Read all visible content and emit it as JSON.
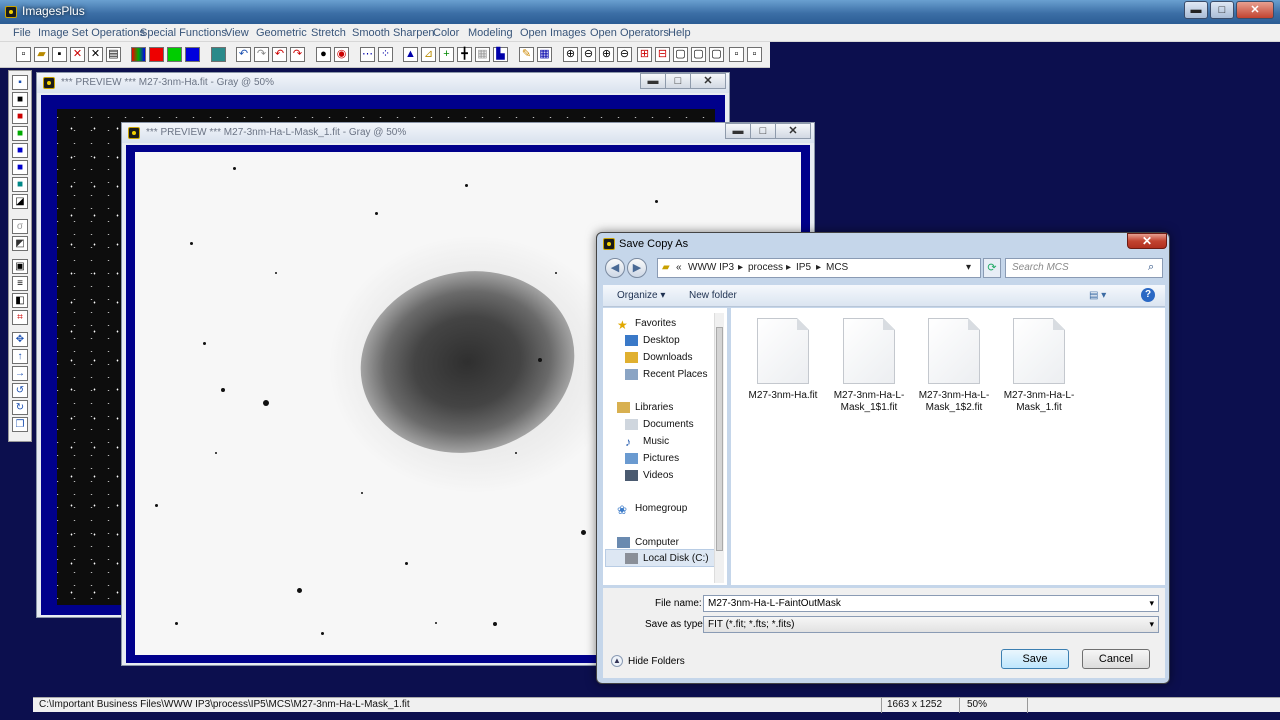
{
  "app": {
    "title": "ImagesPlus"
  },
  "menu": [
    "File",
    "Image Set Operations",
    "Special Functions",
    "View",
    "Geometric",
    "Stretch",
    "Smooth Sharpen",
    "Color",
    "Modeling",
    "Open Images",
    "Open Operators",
    "Help"
  ],
  "windows": {
    "preview1": {
      "title": "*** PREVIEW *** M27-3nm-Ha.fit - Gray @ 50%"
    },
    "preview2": {
      "title": "*** PREVIEW *** M27-3nm-Ha-L-Mask_1.fit - Gray @ 50%"
    }
  },
  "dialog": {
    "title": "Save Copy As",
    "breadcrumb": [
      "«",
      "WWW IP3",
      "process",
      "IP5",
      "MCS"
    ],
    "search_placeholder": "Search MCS",
    "organize_label": "Organize ▾",
    "new_folder_label": "New folder",
    "nav": {
      "favorites": "Favorites",
      "desktop": "Desktop",
      "downloads": "Downloads",
      "recent": "Recent Places",
      "libraries": "Libraries",
      "documents": "Documents",
      "music": "Music",
      "pictures": "Pictures",
      "videos": "Videos",
      "homegroup": "Homegroup",
      "computer": "Computer",
      "localdisk": "Local Disk (C:)"
    },
    "files": [
      "M27-3nm-Ha.fit",
      "M27-3nm-Ha-L-Mask_1$1.fit",
      "M27-3nm-Ha-L-Mask_1$2.fit",
      "M27-3nm-Ha-L-Mask_1.fit"
    ],
    "filename_label": "File name:",
    "filename_value": "M27-3nm-Ha-L-FaintOutMask",
    "savetype_label": "Save as type:",
    "savetype_value": "FIT (*.fit; *.fts; *.fits)",
    "hide_folders": "Hide Folders",
    "save": "Save",
    "cancel": "Cancel"
  },
  "status": {
    "path": "C:\\Important Business Files\\WWW IP3\\process\\IP5\\MCS\\M27-3nm-Ha-L-Mask_1.fit",
    "dims": "1663 x 1252",
    "zoom": "50%"
  },
  "colors": {
    "desktop": "#0c0f4e",
    "accent": "#2b5c94",
    "mdi_frame": "#00008b"
  }
}
